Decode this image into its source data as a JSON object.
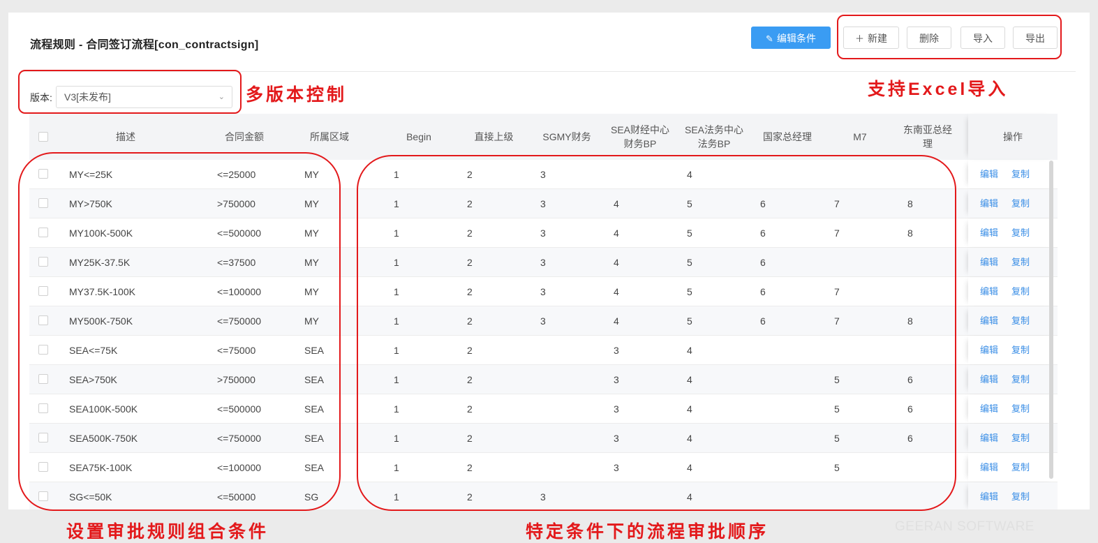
{
  "page": {
    "title": "流程规则 - 合同签订流程[con_contractsign]"
  },
  "toolbar": {
    "edit_conditions": "编辑条件",
    "new": "新建",
    "new_icon": "＋",
    "delete": "删除",
    "import": "导入",
    "export": "导出"
  },
  "version": {
    "label": "版本:",
    "value": "V3[未发布]"
  },
  "table": {
    "headers": {
      "desc": "描述",
      "amount": "合同金额",
      "region": "所属区域",
      "begin": "Begin",
      "direct": "直接上级",
      "sgmy": "SGMY财务",
      "sea_fin": "SEA财经中心财务BP",
      "sea_legal": "SEA法务中心法务BP",
      "country_gm": "国家总经理",
      "m7": "M7",
      "sea_gm": "东南亚总经理",
      "ops": "操作"
    },
    "rows": [
      {
        "desc": "MY<=25K",
        "amount": "<=25000",
        "region": "MY",
        "begin": "1",
        "direct": "2",
        "sgmy": "3",
        "sea_fin": "",
        "sea_legal": "4",
        "country_gm": "",
        "m7": "",
        "sea_gm": ""
      },
      {
        "desc": "MY>750K",
        "amount": ">750000",
        "region": "MY",
        "begin": "1",
        "direct": "2",
        "sgmy": "3",
        "sea_fin": "4",
        "sea_legal": "5",
        "country_gm": "6",
        "m7": "7",
        "sea_gm": "8"
      },
      {
        "desc": "MY100K-500K",
        "amount": "<=500000",
        "region": "MY",
        "begin": "1",
        "direct": "2",
        "sgmy": "3",
        "sea_fin": "4",
        "sea_legal": "5",
        "country_gm": "6",
        "m7": "7",
        "sea_gm": "8"
      },
      {
        "desc": "MY25K-37.5K",
        "amount": "<=37500",
        "region": "MY",
        "begin": "1",
        "direct": "2",
        "sgmy": "3",
        "sea_fin": "4",
        "sea_legal": "5",
        "country_gm": "6",
        "m7": "",
        "sea_gm": ""
      },
      {
        "desc": "MY37.5K-100K",
        "amount": "<=100000",
        "region": "MY",
        "begin": "1",
        "direct": "2",
        "sgmy": "3",
        "sea_fin": "4",
        "sea_legal": "5",
        "country_gm": "6",
        "m7": "7",
        "sea_gm": ""
      },
      {
        "desc": "MY500K-750K",
        "amount": "<=750000",
        "region": "MY",
        "begin": "1",
        "direct": "2",
        "sgmy": "3",
        "sea_fin": "4",
        "sea_legal": "5",
        "country_gm": "6",
        "m7": "7",
        "sea_gm": "8"
      },
      {
        "desc": "SEA<=75K",
        "amount": "<=75000",
        "region": "SEA",
        "begin": "1",
        "direct": "2",
        "sgmy": "",
        "sea_fin": "3",
        "sea_legal": "4",
        "country_gm": "",
        "m7": "",
        "sea_gm": ""
      },
      {
        "desc": "SEA>750K",
        "amount": ">750000",
        "region": "SEA",
        "begin": "1",
        "direct": "2",
        "sgmy": "",
        "sea_fin": "3",
        "sea_legal": "4",
        "country_gm": "",
        "m7": "5",
        "sea_gm": "6"
      },
      {
        "desc": "SEA100K-500K",
        "amount": "<=500000",
        "region": "SEA",
        "begin": "1",
        "direct": "2",
        "sgmy": "",
        "sea_fin": "3",
        "sea_legal": "4",
        "country_gm": "",
        "m7": "5",
        "sea_gm": "6"
      },
      {
        "desc": "SEA500K-750K",
        "amount": "<=750000",
        "region": "SEA",
        "begin": "1",
        "direct": "2",
        "sgmy": "",
        "sea_fin": "3",
        "sea_legal": "4",
        "country_gm": "",
        "m7": "5",
        "sea_gm": "6"
      },
      {
        "desc": "SEA75K-100K",
        "amount": "<=100000",
        "region": "SEA",
        "begin": "1",
        "direct": "2",
        "sgmy": "",
        "sea_fin": "3",
        "sea_legal": "4",
        "country_gm": "",
        "m7": "5",
        "sea_gm": ""
      },
      {
        "desc": "SG<=50K",
        "amount": "<=50000",
        "region": "SG",
        "begin": "1",
        "direct": "2",
        "sgmy": "3",
        "sea_fin": "",
        "sea_legal": "4",
        "country_gm": "",
        "m7": "",
        "sea_gm": ""
      }
    ],
    "actions": {
      "edit": "编辑",
      "copy": "复制"
    }
  },
  "annotations": {
    "version_control": "多版本控制",
    "excel_import": "支持Excel导入",
    "conditions": "设置审批规则组合条件",
    "sequence": "特定条件下的流程审批顺序",
    "color": "#e3191b"
  },
  "watermark": "GEERAN SOFTWARE"
}
